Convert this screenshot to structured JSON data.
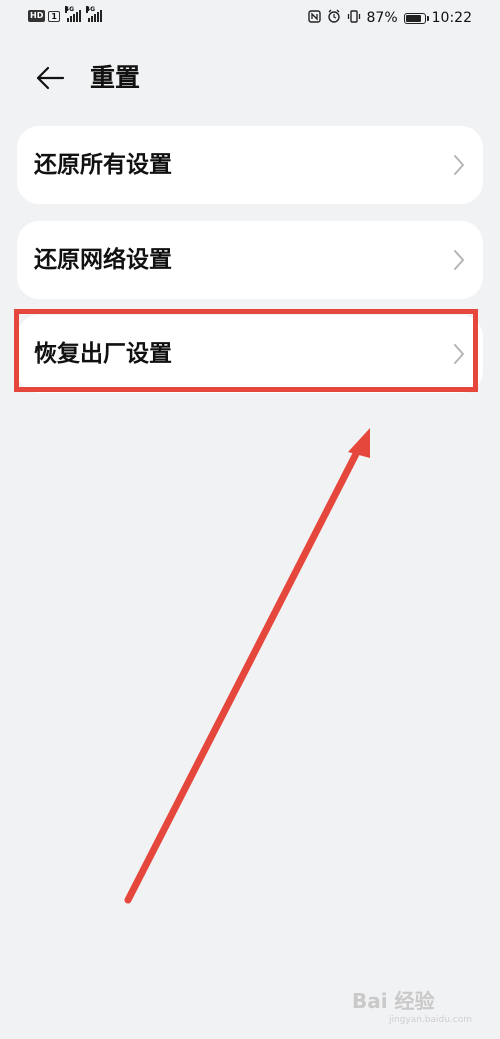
{
  "status_bar": {
    "hd": "HD",
    "sim": "1",
    "network1": "4G",
    "network2": "4G",
    "battery_percent": "87%",
    "battery_level": 0.87,
    "time": "10:22"
  },
  "header": {
    "title": "重置"
  },
  "items": [
    {
      "label": "还原所有设置"
    },
    {
      "label": "还原网络设置"
    },
    {
      "label": "恢复出厂设置"
    }
  ],
  "watermark": {
    "text": "Bai 经验",
    "url": "jingyan.baidu.com"
  },
  "colors": {
    "background": "#f1f2f4",
    "card": "#ffffff",
    "highlight": "#e5473d",
    "text": "#111111",
    "chevron": "#b5b5b5"
  }
}
